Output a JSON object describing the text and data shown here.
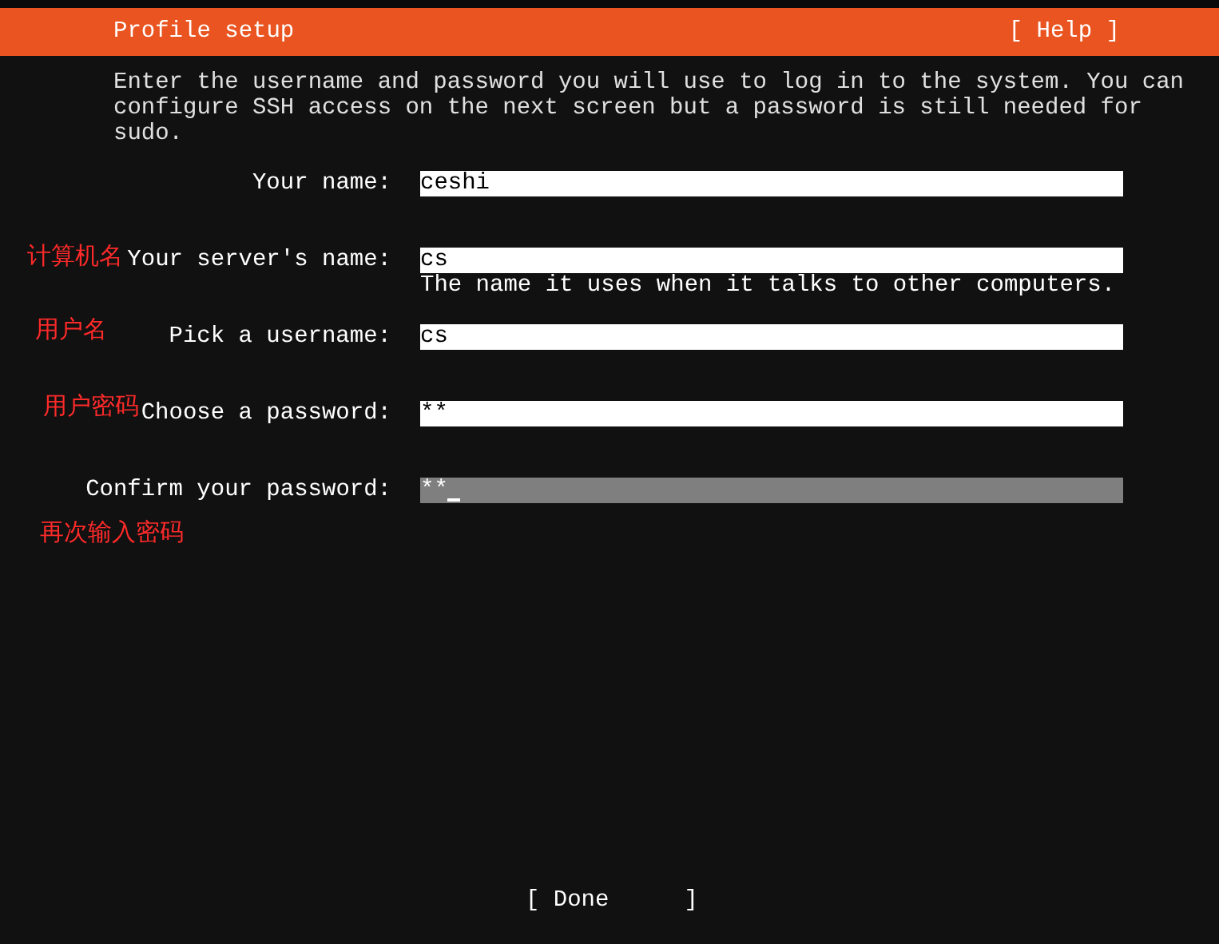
{
  "header": {
    "title": "Profile setup",
    "help": "[ Help ]"
  },
  "intro": "Enter the username and password you will use to log in to the system. You can configure SSH access on the next screen but a password is still needed for sudo.",
  "fields": [
    {
      "label": "Your name:",
      "value": "ceshi",
      "focused": false
    },
    {
      "label": "Your server's name:",
      "value": "cs",
      "hint": "The name it uses when it talks to other computers.",
      "focused": false
    },
    {
      "label": "Pick a username:",
      "value": "cs",
      "focused": false
    },
    {
      "label": "Choose a password:",
      "value": "**",
      "focused": false
    },
    {
      "label": "Confirm your password:",
      "value": "**",
      "focused": true
    }
  ],
  "done_button": {
    "open": "[ Done",
    "close": "]"
  },
  "annotations": [
    "计算机名",
    "用户名",
    "用户密码",
    "再次输入密码"
  ]
}
